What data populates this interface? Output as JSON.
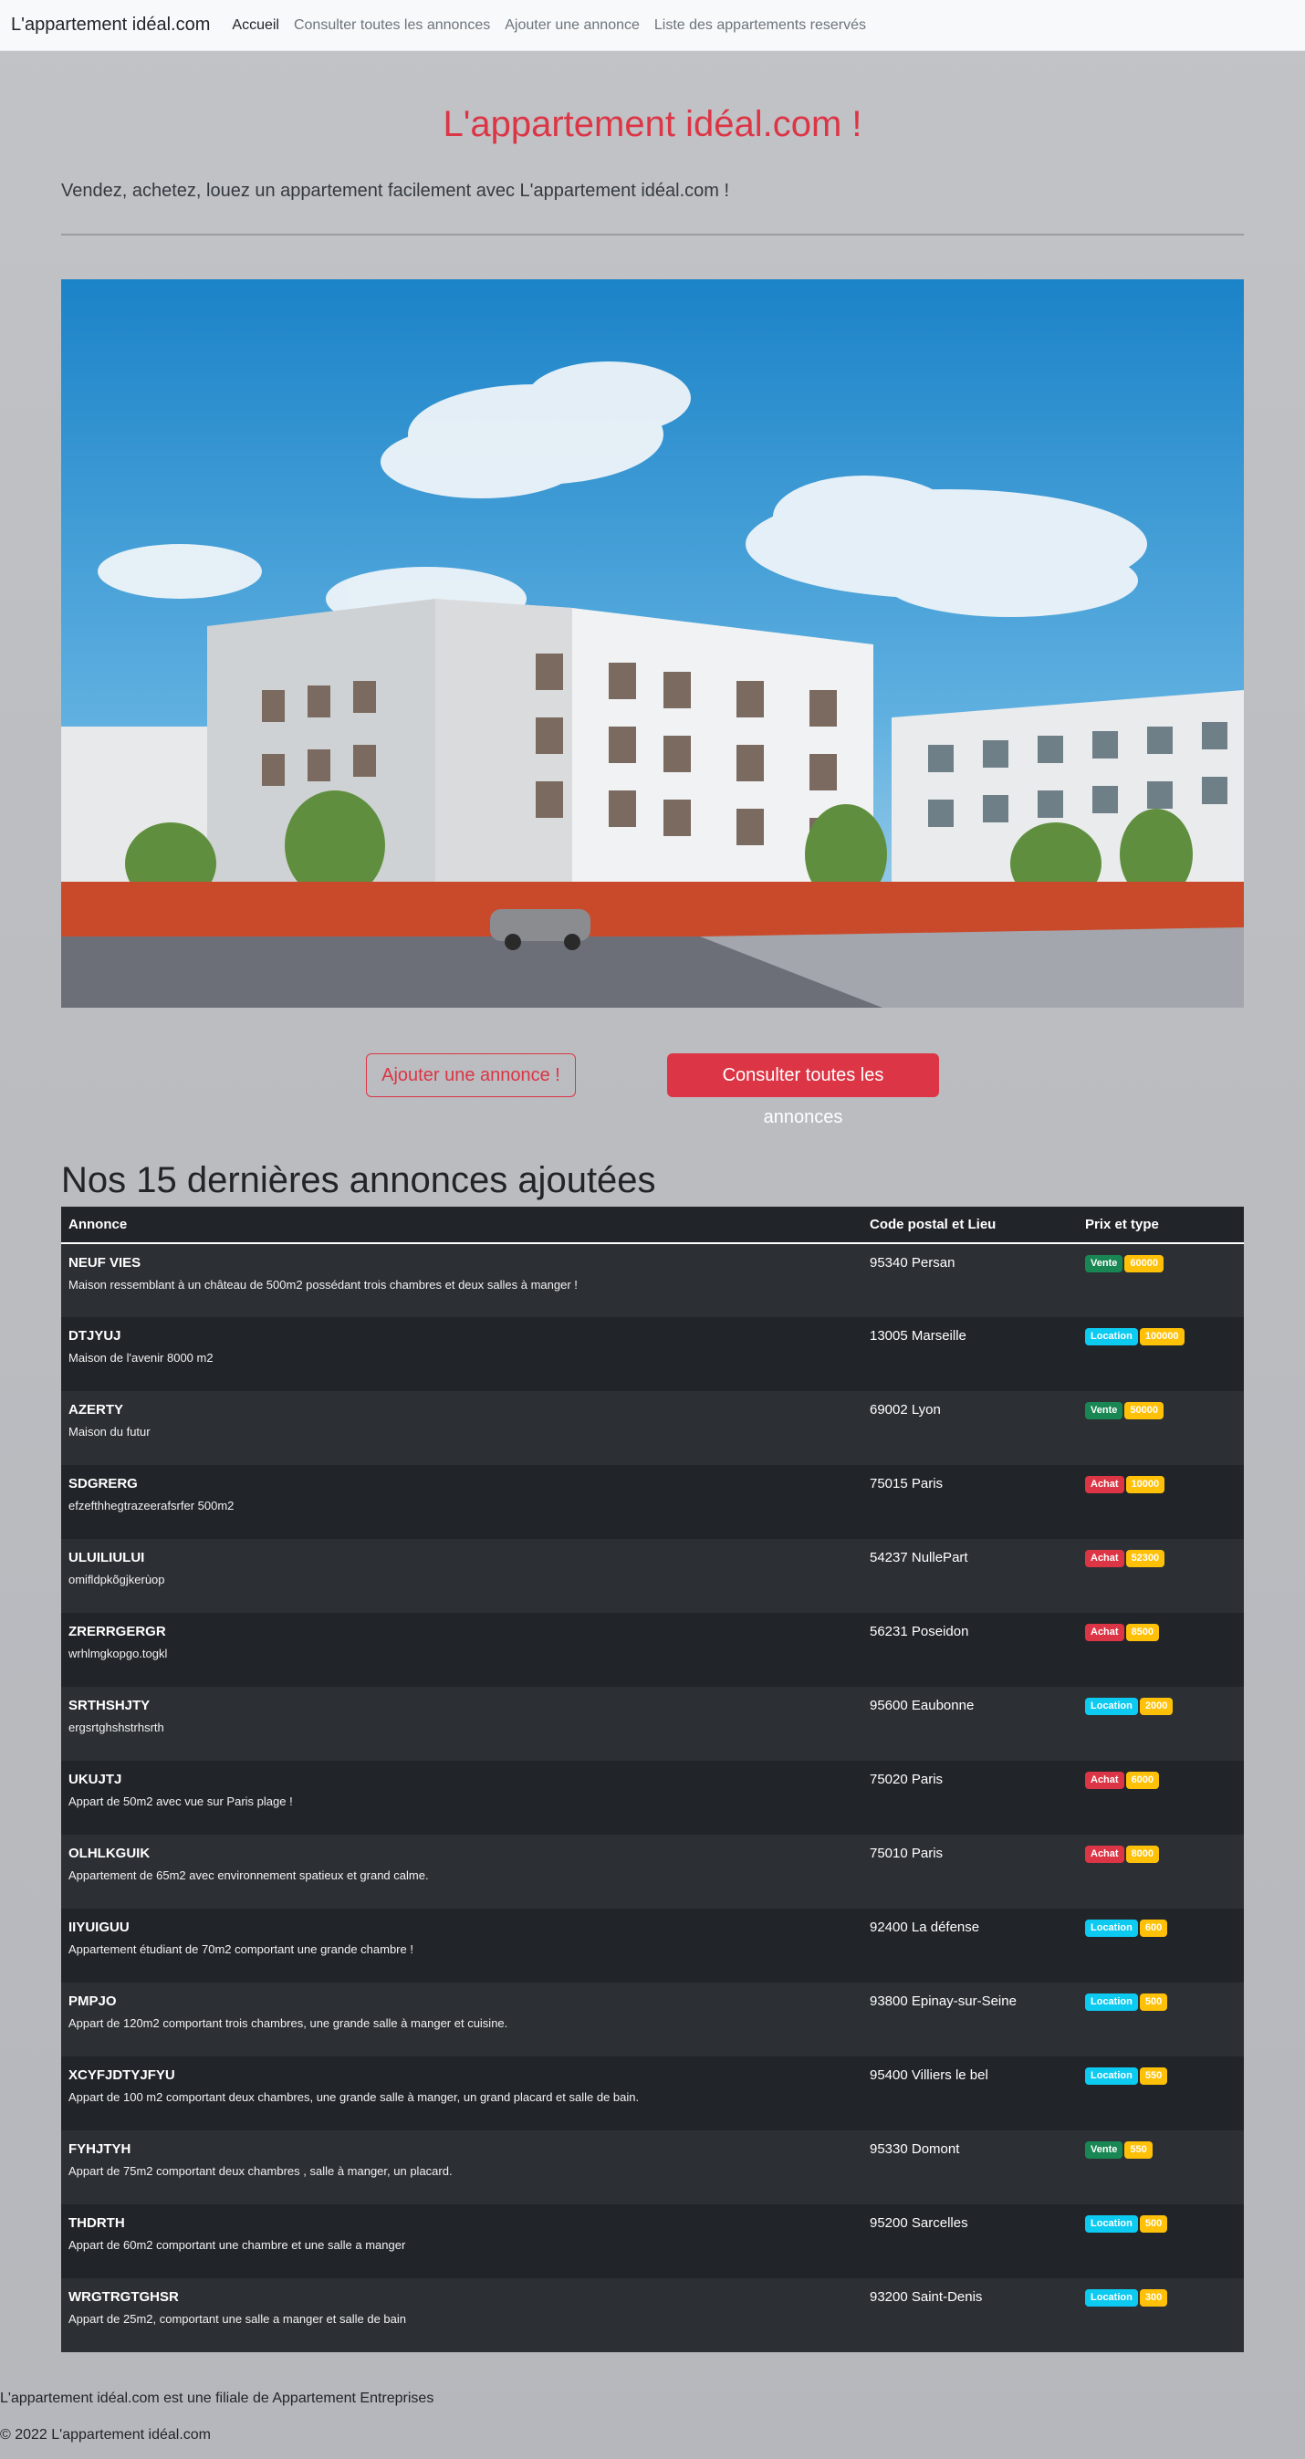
{
  "navbar": {
    "brand": "L'appartement idéal.com",
    "links": [
      {
        "label": "Accueil",
        "active": true
      },
      {
        "label": "Consulter toutes les annonces",
        "active": false
      },
      {
        "label": "Ajouter une annonce",
        "active": false
      },
      {
        "label": "Liste des appartements reservés",
        "active": false
      }
    ]
  },
  "hero": {
    "title": "L'appartement idéal.com !",
    "lead": "Vendez, achetez, louez un appartement facilement avec L'appartement idéal.com !"
  },
  "actions": {
    "add_label": "Ajouter une annonce !",
    "browse_label": "Consulter toutes les annonces"
  },
  "listings": {
    "title": "Nos 15 dernières annonces ajoutées",
    "headers": [
      "Annonce",
      "Code postal et Lieu",
      "Prix et type"
    ],
    "rows": [
      {
        "title": "NEUF VIES",
        "desc": "Maison ressemblant à un château de 500m2 possédant trois chambres et deux salles à manger !",
        "place": "95340 Persan",
        "type": "Vente",
        "price": "60000"
      },
      {
        "title": "DTJYUJ",
        "desc": "Maison de l'avenir 8000 m2",
        "place": "13005 Marseille",
        "type": "Location",
        "price": "100000"
      },
      {
        "title": "AZERTY",
        "desc": "Maison du futur",
        "place": "69002 Lyon",
        "type": "Vente",
        "price": "50000"
      },
      {
        "title": "SDGRERG",
        "desc": "efzefthhegtrazeerafsrfer 500m2",
        "place": "75015 Paris",
        "type": "Achat",
        "price": "10000"
      },
      {
        "title": "ULUILIULUI",
        "desc": "omifldpkõgjkerùop",
        "place": "54237 NullePart",
        "type": "Achat",
        "price": "52300"
      },
      {
        "title": "ZRERRGERGR",
        "desc": "wrhlmgkopgo.togkl",
        "place": "56231 Poseidon",
        "type": "Achat",
        "price": "8500"
      },
      {
        "title": "SRTHSHJTY",
        "desc": "ergsrtghshstrhsrth",
        "place": "95600 Eaubonne",
        "type": "Location",
        "price": "2000"
      },
      {
        "title": "UKUJTJ",
        "desc": "Appart de 50m2 avec vue sur Paris plage !",
        "place": "75020 Paris",
        "type": "Achat",
        "price": "6000"
      },
      {
        "title": "OLHLKGUIK",
        "desc": "Appartement de 65m2 avec environnement spatieux et grand calme.",
        "place": "75010 Paris",
        "type": "Achat",
        "price": "8000"
      },
      {
        "title": "IIYUIGUU",
        "desc": "Appartement étudiant de 70m2 comportant une grande chambre !",
        "place": "92400 La défense",
        "type": "Location",
        "price": "600"
      },
      {
        "title": "PMPJO",
        "desc": "Appart de 120m2 comportant trois chambres, une grande salle à manger et cuisine.",
        "place": "93800 Epinay-sur-Seine",
        "type": "Location",
        "price": "500"
      },
      {
        "title": "XCYFJDTYJFYU",
        "desc": "Appart de 100 m2 comportant deux chambres, une grande salle à manger, un grand placard et salle de bain.",
        "place": "95400 Villiers le bel",
        "type": "Location",
        "price": "550"
      },
      {
        "title": "FYHJTYH",
        "desc": "Appart de 75m2 comportant deux chambres , salle à manger, un placard.",
        "place": "95330 Domont",
        "type": "Vente",
        "price": "550"
      },
      {
        "title": "THDRTH",
        "desc": "Appart de 60m2 comportant une chambre et une salle a manger",
        "place": "95200 Sarcelles",
        "type": "Location",
        "price": "500"
      },
      {
        "title": "WRGTRGTGHSR",
        "desc": "Appart de 25m2, comportant une salle a manger et salle de bain",
        "place": "93200 Saint-Denis",
        "type": "Location",
        "price": "300"
      }
    ]
  },
  "footer": {
    "line1": "L'appartement idéal.com est une filiale de Appartement Entreprises",
    "line2": "© 2022 L'appartement idéal.com"
  },
  "colors": {
    "accent": "#dc3545",
    "vente": "#198754",
    "location": "#0dcaf0",
    "achat": "#dc3545",
    "price": "#ffc107"
  }
}
